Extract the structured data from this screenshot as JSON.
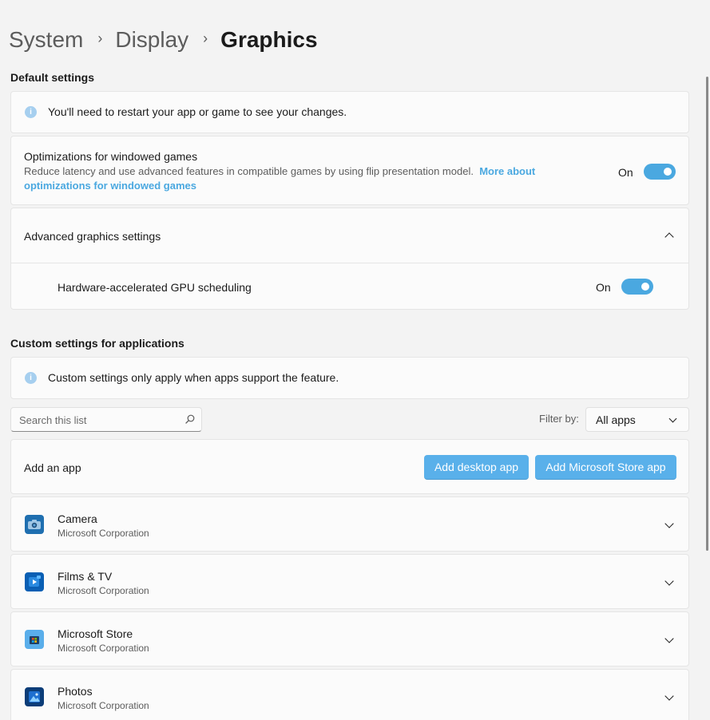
{
  "breadcrumb": {
    "items": [
      "System",
      "Display"
    ],
    "current": "Graphics"
  },
  "default_settings": {
    "header": "Default settings",
    "info_banner": "You'll need to restart your app or game to see your changes.",
    "windowed_games": {
      "title": "Optimizations for windowed games",
      "description": "Reduce latency and use advanced features in compatible games by using flip presentation model.",
      "link_line1": "More about",
      "link_line2": "optimizations for windowed games",
      "toggle_state": "On"
    },
    "advanced": {
      "title": "Advanced graphics settings",
      "gpu_scheduling": {
        "label": "Hardware-accelerated GPU scheduling",
        "toggle_state": "On"
      }
    }
  },
  "custom_settings": {
    "header": "Custom settings for applications",
    "info_banner": "Custom settings only apply when apps support the feature.",
    "search_placeholder": "Search this list",
    "filter_label": "Filter by:",
    "filter_value": "All apps",
    "add_app": {
      "label": "Add an app",
      "desktop_button": "Add desktop app",
      "store_button": "Add Microsoft Store app"
    },
    "apps": [
      {
        "name": "Camera",
        "publisher": "Microsoft Corporation",
        "icon": "camera-app-icon"
      },
      {
        "name": "Films & TV",
        "publisher": "Microsoft Corporation",
        "icon": "films-tv-app-icon"
      },
      {
        "name": "Microsoft Store",
        "publisher": "Microsoft Corporation",
        "icon": "microsoft-store-app-icon"
      },
      {
        "name": "Photos",
        "publisher": "Microsoft Corporation",
        "icon": "photos-app-icon"
      }
    ]
  },
  "colors": {
    "accent": "#4aa8e0",
    "button": "#59b0ea",
    "background": "#f3f3f3",
    "card": "#fbfbfb"
  }
}
